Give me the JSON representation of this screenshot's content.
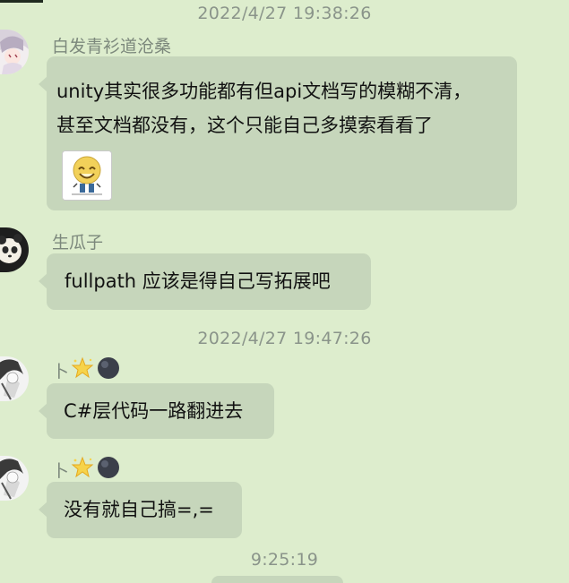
{
  "colors": {
    "background": "#ddedcd",
    "bubble": "#c6d6bb",
    "meta_text": "#8a948a"
  },
  "timestamps": [
    "2022/4/27 19:38:26",
    "2022/4/27 19:47:26",
    "9:25:19"
  ],
  "messages": [
    {
      "sender": "白发青衫道沧桑",
      "lines": [
        "unity其实很多功能都有但api文档写的模糊不清，",
        "甚至文档都没有，这个只能自己多摸索看看了"
      ],
      "sticker": "laughing-face-sticker"
    },
    {
      "sender": "生瓜子",
      "lines": [
        "fullpath 应该是得自己写拓展吧"
      ]
    },
    {
      "sender": "卜",
      "icons": [
        "star-badge-icon",
        "dark-orb-icon"
      ],
      "lines": [
        "C#层代码一路翻进去"
      ]
    },
    {
      "sender": "卜",
      "icons": [
        "star-badge-icon",
        "dark-orb-icon"
      ],
      "lines": [
        "没有就自己搞=,="
      ]
    }
  ]
}
